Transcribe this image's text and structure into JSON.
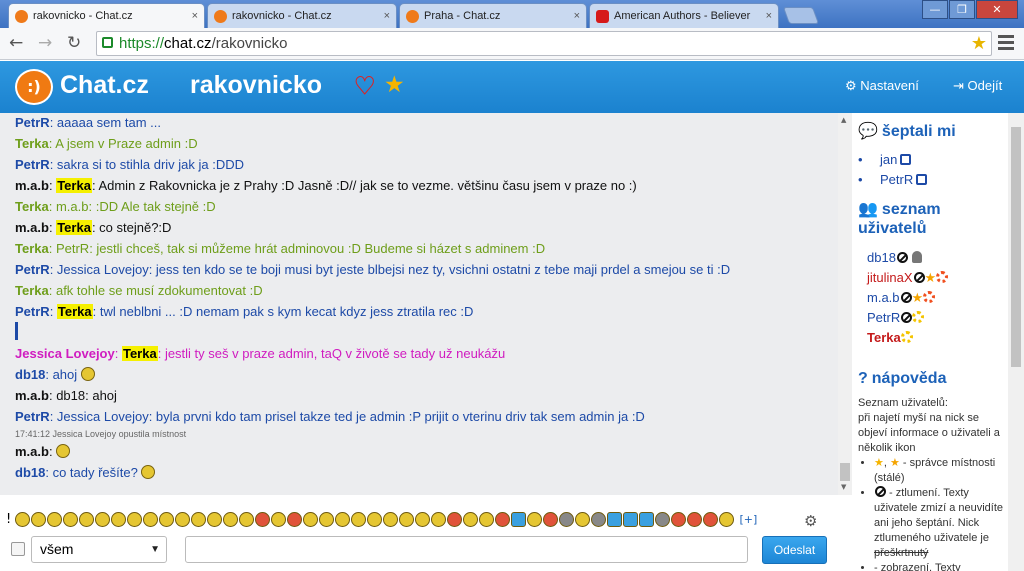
{
  "browser": {
    "tabs": [
      {
        "title": "rakovnicko - Chat.cz",
        "active": true
      },
      {
        "title": "rakovnicko - Chat.cz",
        "active": false
      },
      {
        "title": "Praha - Chat.cz",
        "active": false
      },
      {
        "title": "American Authors - Believer",
        "active": false
      }
    ],
    "url_scheme": "https://",
    "url_host": "chat.cz",
    "url_path": "/rakovnicko",
    "tab_close": "×",
    "win_min": "—",
    "win_max": "❐",
    "win_close": "✕",
    "back": "←",
    "forward": "→",
    "reload": "↻",
    "bookmark_star": "★"
  },
  "header": {
    "logo_glyph": ":)",
    "logo_text": "Chat.cz",
    "room": "rakovnicko",
    "heart": "♥",
    "star": "★",
    "settings_label": "Nastavení",
    "logout_label": "Odejít",
    "settings_icon": "⚙",
    "logout_icon": "⇥"
  },
  "messages": [
    {
      "nick": "PetrR",
      "nick_color": "blue",
      "text": "aaaaa sem tam ...",
      "text_color": "blue"
    },
    {
      "nick": "Terka",
      "nick_color": "green",
      "text": "A jsem v Praze admin :D",
      "text_color": "green"
    },
    {
      "nick": "PetrR",
      "nick_color": "blue",
      "text": "sakra si to stihla driv jak ja :DDD",
      "text_color": "blue"
    },
    {
      "nick": "m.a.b",
      "nick_color": "black",
      "to": "Terka",
      "text": "Admin z Rakovnicka je z Prahy :D Jasně :D// jak se to vezme. většinu času jsem v praze no :)",
      "text_color": "black"
    },
    {
      "nick": "Terka",
      "nick_color": "green",
      "text": "m.a.b: :DD Ale tak stejně :D",
      "text_color": "green"
    },
    {
      "nick": "m.a.b",
      "nick_color": "black",
      "to": "Terka",
      "text": "co stejně?:D",
      "text_color": "black"
    },
    {
      "nick": "Terka",
      "nick_color": "green",
      "text": "PetrR: jestli chceš, tak si můžeme hrát adminovou :D Budeme si házet s adminem :D",
      "text_color": "green"
    },
    {
      "nick": "PetrR",
      "nick_color": "blue",
      "text": "Jessica Lovejoy: jess ten kdo se te boji musi byt jeste blbejsi nez ty, vsichni ostatni z tebe maji prdel a smejou se ti :D",
      "text_color": "blue"
    },
    {
      "nick": "Terka",
      "nick_color": "green",
      "text": "afk tohle se musí zdokumentovat :D",
      "text_color": "green"
    },
    {
      "nick": "PetrR",
      "nick_color": "blue",
      "to": "Terka",
      "text": "twl neblbni ... :D nemam pak s kym kecat kdyz jess ztratila rec :D",
      "text_color": "blue"
    },
    {
      "nick": "Jessica Lovejoy",
      "nick_color": "pink",
      "to": "Terka",
      "text": "jestli ty seš v praze admin, taQ v životě se tady už neukážu",
      "text_color": "pink"
    },
    {
      "nick": "db18",
      "nick_color": "blue",
      "text": "ahoj",
      "text_color": "blue",
      "smiley": true
    },
    {
      "nick": "m.a.b",
      "nick_color": "black",
      "text": "db18: ahoj",
      "text_color": "black"
    },
    {
      "nick": "PetrR",
      "nick_color": "blue",
      "text": "Jessica Lovejoy: byla prvni kdo tam prisel takze ted je admin :P prijit o vterinu driv tak sem admin ja :D",
      "text_color": "blue"
    },
    {
      "system": "17:41:12 Jessica Lovejoy opustila místnost"
    },
    {
      "nick": "m.a.b",
      "nick_color": "black",
      "text": "",
      "text_color": "black",
      "smiley": true
    },
    {
      "nick": "db18",
      "nick_color": "blue",
      "text": "co tady řešíte?",
      "text_color": "blue",
      "smiley": true
    }
  ],
  "sidebar": {
    "whispers_title": "šeptali mi",
    "whispers": [
      "jan",
      "PetrR"
    ],
    "users_title": "seznam uživatelů",
    "users": [
      {
        "name": "db18",
        "color": "#1d4aa7",
        "marks": [
          "ban",
          "person"
        ]
      },
      {
        "name": "jitulinaX",
        "color": "#c41a1a",
        "marks": [
          "ban",
          "star",
          "sun-red"
        ]
      },
      {
        "name": "m.a.b",
        "color": "#1d4aa7",
        "marks": [
          "ban",
          "star",
          "sun-red"
        ]
      },
      {
        "name": "PetrR",
        "color": "#1d4aa7",
        "marks": [
          "ban",
          "sun"
        ]
      },
      {
        "name": "Terka",
        "color": "#c41a1a",
        "bold": true,
        "marks": [
          "sun"
        ]
      }
    ],
    "help_title": "nápověda",
    "help_intro": "Seznam uživatelů:",
    "help_p1": "při najetí myší na nick se objeví informace o uživateli a několik ikon",
    "help_li1": " - správce místnosti (stálé)",
    "help_li2": " - ztlumení. Texty uživatele zmizí a neuvidíte ani jeho šeptání. Nick ztlumeného uživatele je",
    "help_li2_strike": "přeškrtnutý",
    "help_li3": " - zobrazení. Texty"
  },
  "input_bar": {
    "target_value": "všem",
    "send_label": "Odeslat",
    "more_smileys": "[+]",
    "message_value": ""
  },
  "colors": {
    "header": "#2490da",
    "chat_bg": "#ecedef",
    "nick_blue": "#1d4aa7",
    "nick_green": "#6e9e1a",
    "nick_pink": "#d01cc0",
    "highlight": "#f5f000"
  }
}
